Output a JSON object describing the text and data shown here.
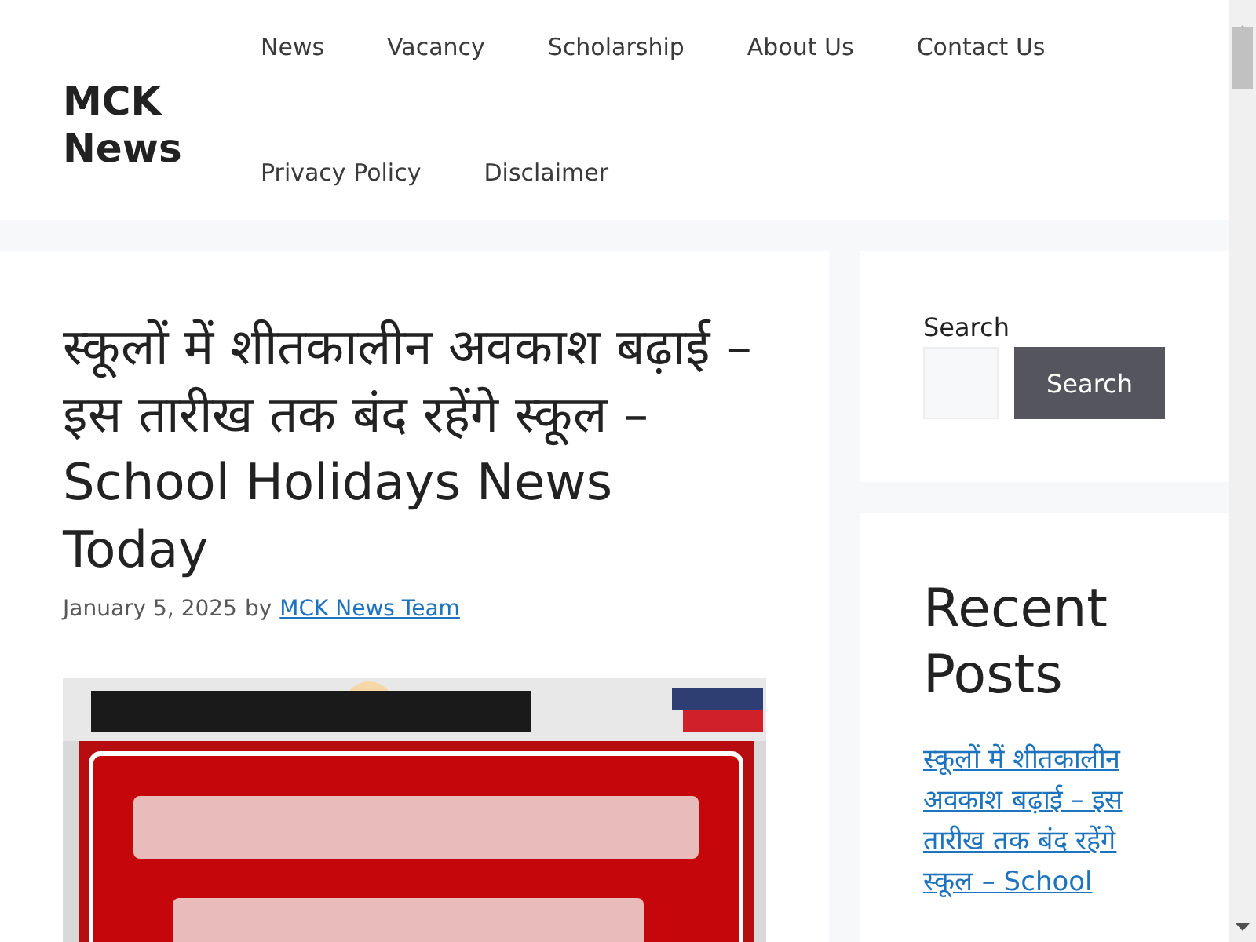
{
  "site_title": "MCK News",
  "nav": [
    {
      "label": "News"
    },
    {
      "label": "Vacancy"
    },
    {
      "label": "Scholarship"
    },
    {
      "label": "About Us"
    },
    {
      "label": "Contact Us"
    },
    {
      "label": "Privacy Policy"
    },
    {
      "label": "Disclaimer"
    }
  ],
  "article": {
    "title": "स्कूलों में शीतकालीन अवकाश बढ़ाई – इस तारीख तक बंद रहेंगे स्कूल – School Holidays News Today",
    "date": "January 5, 2025",
    "by": "by",
    "author": "MCK News Team"
  },
  "search_widget": {
    "label": "Search",
    "button": "Search"
  },
  "recent_posts": {
    "title": "Recent Posts",
    "items": [
      {
        "label": "स्कूलों में शीतकालीन अवकाश बढ़ाई – इस तारीख तक बंद रहेंगे स्कूल – School"
      }
    ]
  }
}
